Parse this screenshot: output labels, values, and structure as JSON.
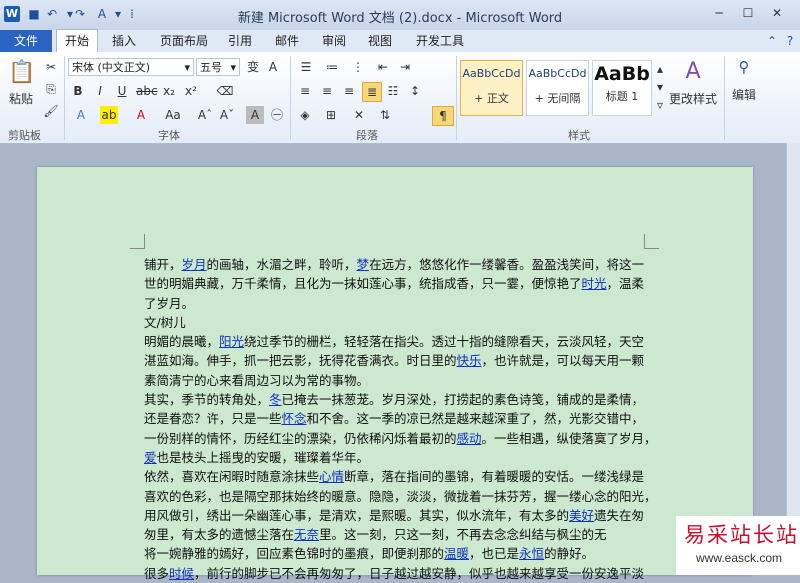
{
  "window": {
    "title": "新建 Microsoft Word 文档 (2).docx  -  Microsoft Word"
  },
  "menu": {
    "file": "文件",
    "tabs": [
      "开始",
      "插入",
      "页面布局",
      "引用",
      "邮件",
      "审阅",
      "视图",
      "开发工具"
    ]
  },
  "ribbon": {
    "groups": {
      "clipboard": "剪贴板",
      "font": "字体",
      "paragraph": "段落",
      "styles": "样式",
      "editing": "编辑"
    },
    "paste_label": "粘贴",
    "font_name": "宋体 (中文正文)",
    "font_size": "五号",
    "styles": [
      {
        "preview": "AaBbCcDd",
        "name": "+ 正文"
      },
      {
        "preview": "AaBbCcDd",
        "name": "+ 无间隔"
      },
      {
        "preview": "AaBb",
        "name": "标题 1"
      }
    ],
    "change_styles": "更改样式",
    "edit": "编辑"
  },
  "document": {
    "lines": [
      [
        "铺开，",
        {
          "l": "岁月"
        },
        "的画轴，水湄之畔，聆听，",
        {
          "l": "梦"
        },
        "在远方，悠悠化作一缕馨香。盈盈浅笑间，将这一"
      ],
      [
        "世的明媚典藏，万千柔情，且化为一抹如莲心事，统指成香，只一霎，便惊艳了",
        {
          "l": "时光"
        },
        "，温柔"
      ],
      [
        "了岁月。"
      ],
      [
        "文/树儿"
      ],
      [
        "明媚的晨曦，",
        {
          "l": "阳光"
        },
        "绕过季节的栅栏，轻轻落在指尖。透过十指的缝隙看天，云淡风轻，天空"
      ],
      [
        "湛蓝如海。伸手，抓一把云影，抚得花香满衣。时日里的",
        {
          "l": "快乐"
        },
        "，也许就是，可以每天用一颗"
      ],
      [
        "素简清宁的心来看周边习以为常的事物。"
      ],
      [
        "其实，季节的转角处，",
        {
          "l": "冬"
        },
        "已掩去一抹葱茏。岁月深处，打捞起的素色诗笺，铺成的是柔情，"
      ],
      [
        "还是眷恋？许，只是一些",
        {
          "l": "怀念"
        },
        "和不舍。这一季的凉已然是越来越深重了，然，光影交错中，"
      ],
      [
        "一份别样的情怀，历经红尘的漂染，仍依稀闪烁着最初的",
        {
          "l": "感动"
        },
        "。一些相遇，纵使落寞了岁月，"
      ],
      [
        {
          "l": "爱"
        },
        "也是枝头上摇曳的安暖，璀璨着华年。"
      ],
      [
        "依然，喜欢在闲暇时随意涂抹些",
        {
          "l": "心情"
        },
        "断章，落在指间的墨锦，有着暖暖的安恬。一缕浅绿是"
      ],
      [
        "喜欢的色彩，也是隔空那抹始终的暖意。隐隐，淡淡，微拢着一抹芬芳，握一缕心念的阳光，"
      ],
      [
        "用风做引，绣出一朵幽莲心事，是清欢，是熙暖。其实，似水流年，有太多的",
        {
          "l": "美好"
        },
        "遗失在匆"
      ],
      [
        "匆里，有太多的遗憾尘落在",
        {
          "l": "无奈"
        },
        "里。这一刻，只这一刻，不再去念念纠结与枫尘的无"
      ],
      [
        "将一婉静雅的嫣好，回应素色锦时的墨痕，即便刹那的",
        {
          "l": "温暖"
        },
        "，也已是",
        {
          "l": "永恒"
        },
        "的静好。"
      ],
      [
        "很多",
        {
          "l": "时候"
        },
        "，前行的脚步已不会再匆匆了，日子越过越安静，似乎也越来越享受一份安逸平淡"
      ]
    ]
  },
  "watermark": {
    "cn": "易采站长站",
    "en": "www.easck.com"
  }
}
